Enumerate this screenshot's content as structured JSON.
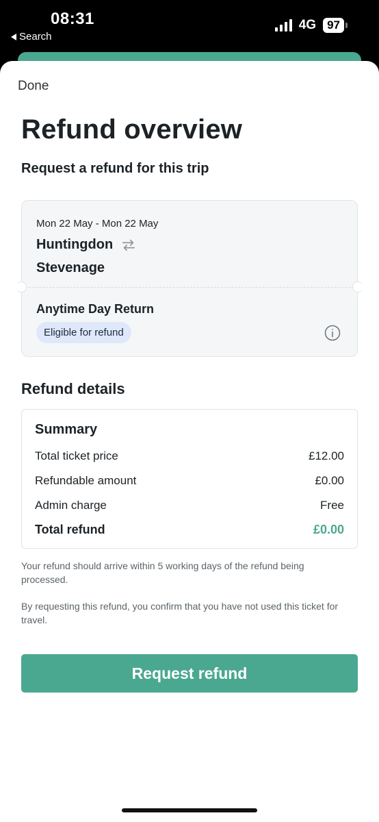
{
  "status_bar": {
    "time": "08:31",
    "back_label": "Search",
    "network": "4G",
    "battery": "97"
  },
  "header": {
    "done_label": "Done",
    "title": "Refund overview",
    "subtitle": "Request a refund for this trip"
  },
  "trip": {
    "date_range": "Mon 22 May - Mon 22 May",
    "origin": "Huntingdon",
    "destination": "Stevenage",
    "swap_icon": "swap-arrows-icon",
    "ticket_type": "Anytime Day Return",
    "eligibility_badge": "Eligible for refund",
    "info_icon": "info-icon"
  },
  "refund_details": {
    "heading": "Refund details",
    "summary_title": "Summary",
    "rows": [
      {
        "label": "Total ticket price",
        "value": "£12.00"
      },
      {
        "label": "Refundable amount",
        "value": "£0.00"
      },
      {
        "label": "Admin charge",
        "value": "Free"
      }
    ],
    "total": {
      "label": "Total refund",
      "value": "£0.00"
    }
  },
  "notes": [
    "Your refund should arrive within 5 working days of the refund being processed.",
    "By requesting this refund, you confirm that you have not used this ticket for travel."
  ],
  "actions": {
    "request_refund_label": "Request refund"
  },
  "colors": {
    "accent": "#4ba890",
    "badge_bg": "#dfe8fb",
    "card_bg": "#f4f6f8"
  }
}
